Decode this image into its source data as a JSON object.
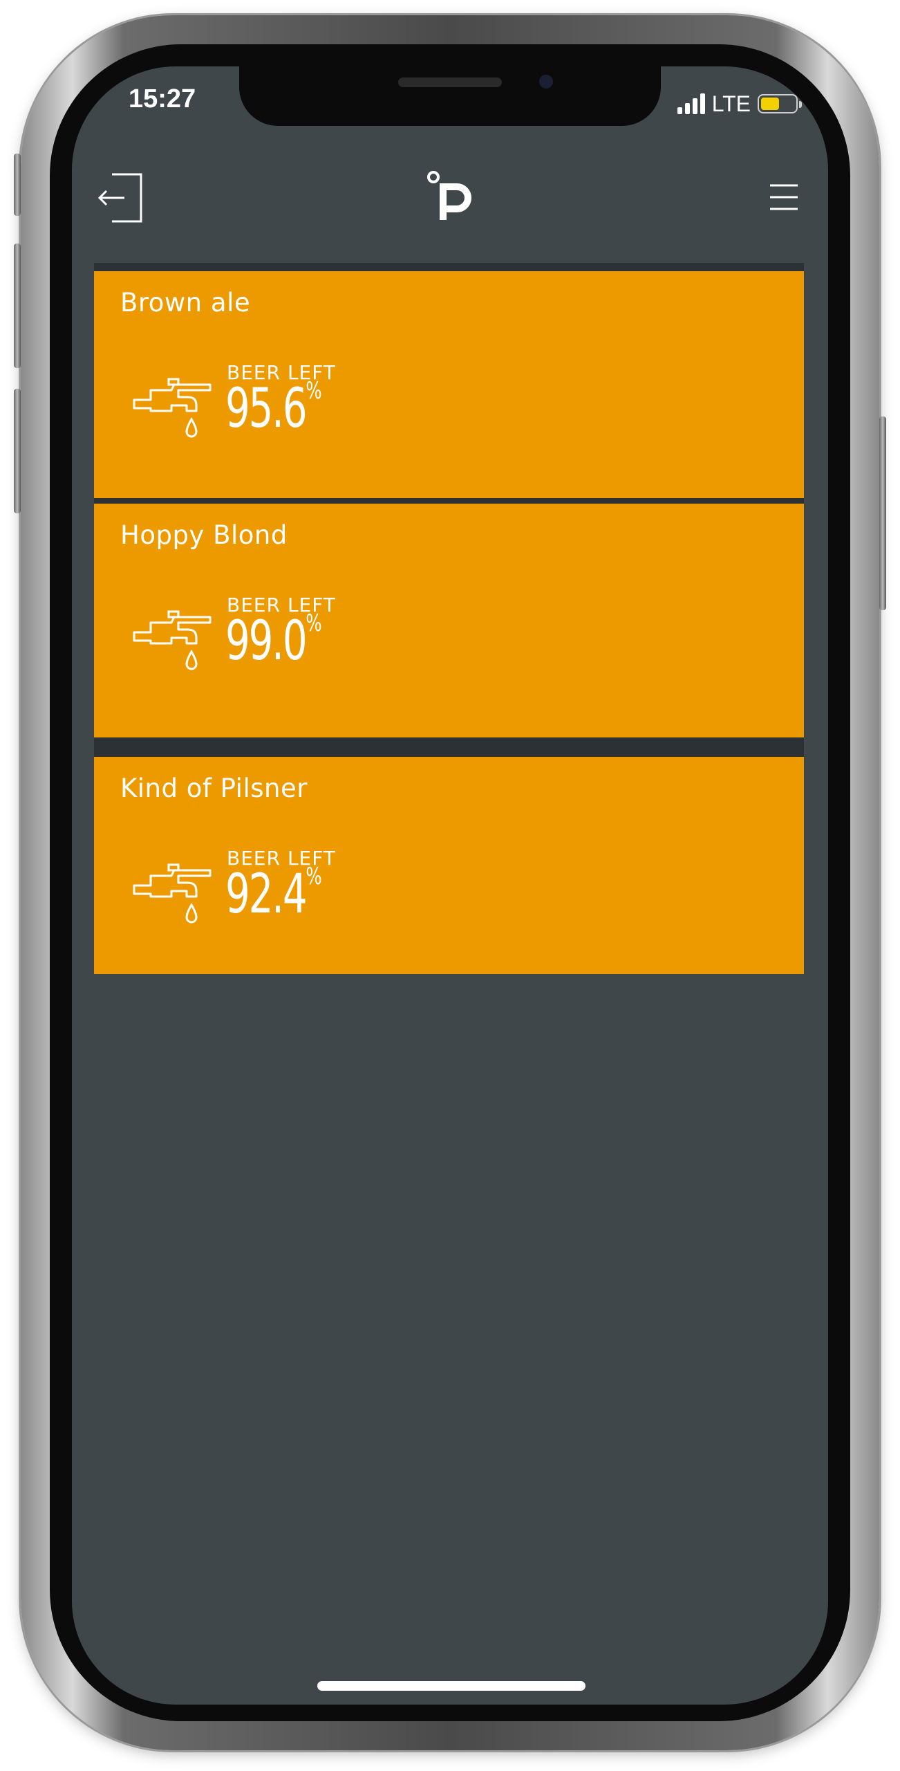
{
  "status_bar": {
    "time": "15:27",
    "network": "LTE",
    "battery_color": "#f5d000"
  },
  "header": {
    "logout_icon": "logout-icon",
    "logo_icon": "app-logo",
    "menu_icon": "hamburger-menu-icon"
  },
  "theme": {
    "background": "#3f474a",
    "card_color": "#ec9a00",
    "text_color": "#ffffff"
  },
  "taps": [
    {
      "name": "Brown ale",
      "label": "BEER LEFT",
      "value": "95.6",
      "unit": "%",
      "icon": "beer-tap-icon"
    },
    {
      "name": "Hoppy Blond",
      "label": "BEER LEFT",
      "value": "99.0",
      "unit": "%",
      "icon": "beer-tap-icon"
    },
    {
      "name": "Kind of Pilsner",
      "label": "BEER LEFT",
      "value": "92.4",
      "unit": "%",
      "icon": "beer-tap-icon"
    }
  ]
}
